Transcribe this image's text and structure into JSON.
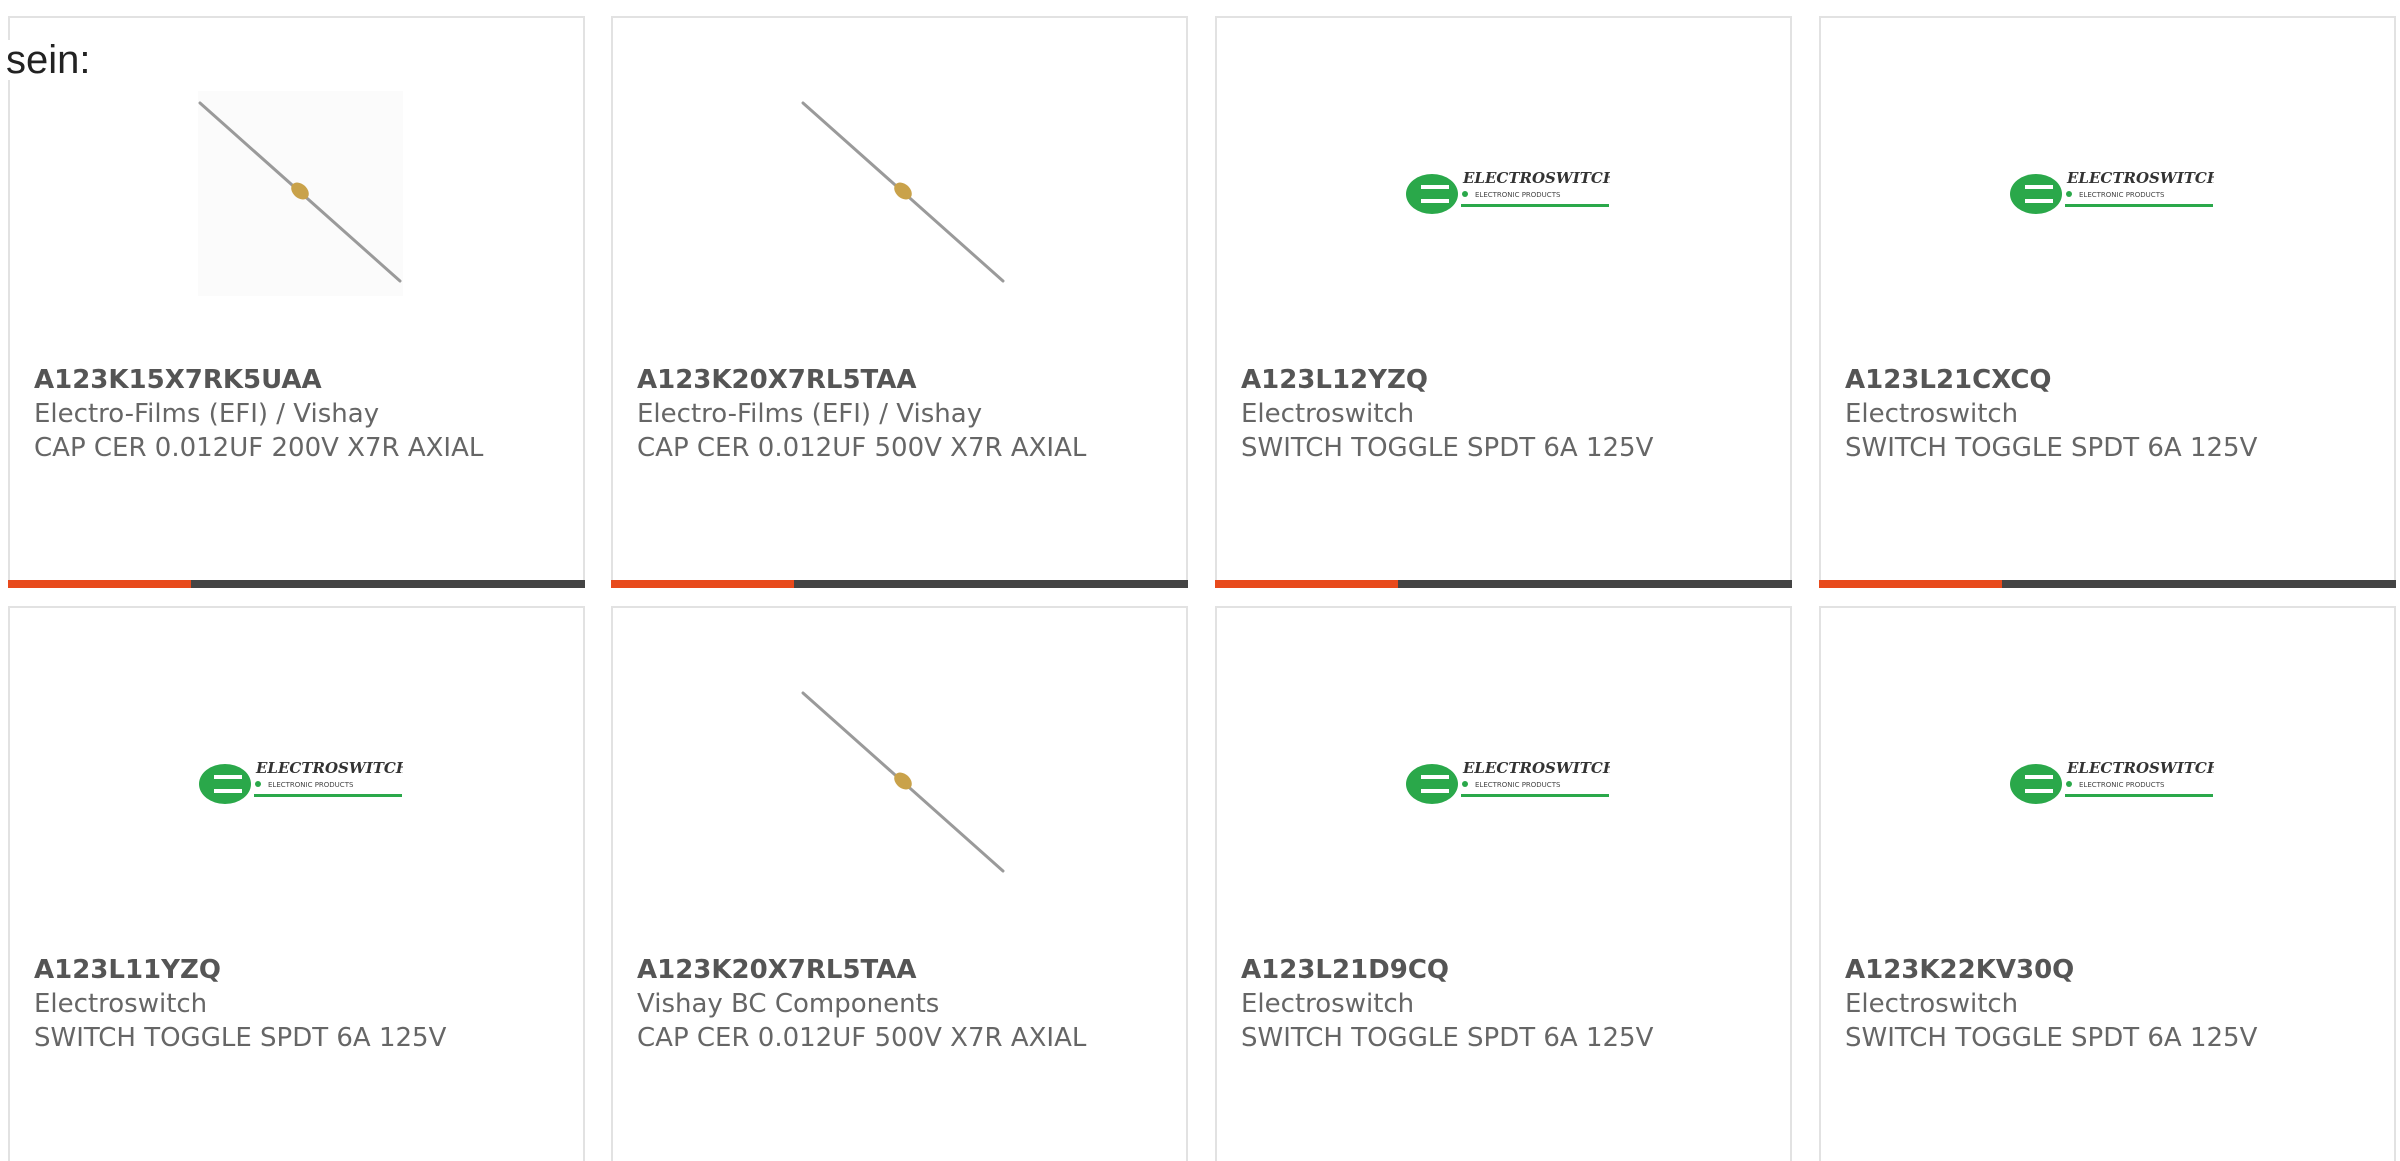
{
  "intro_text": "sein:",
  "colors": {
    "accent": "#e84a1c",
    "bar": "#444444",
    "logo_green": "#2aa84a"
  },
  "cards": [
    {
      "part": "A123K15X7RK5UAA",
      "manufacturer": "Electro-Films (EFI) / Vishay",
      "description": "CAP CER 0.012UF 200V X7R AXIAL",
      "image": "capacitor-image",
      "has_bar": true
    },
    {
      "part": "A123K20X7RL5TAA",
      "manufacturer": "Electro-Films (EFI) / Vishay",
      "description": "CAP CER 0.012UF 500V X7R AXIAL",
      "image": "capacitor-image",
      "has_bar": true
    },
    {
      "part": "A123L12YZQ",
      "manufacturer": "Electroswitch",
      "description": "SWITCH TOGGLE SPDT 6A 125V",
      "image": "electroswitch-logo",
      "logo_title": "ELECTROSWITCH",
      "logo_subtitle": "ELECTRONIC PRODUCTS",
      "has_bar": true
    },
    {
      "part": "A123L21CXCQ",
      "manufacturer": "Electroswitch",
      "description": "SWITCH TOGGLE SPDT 6A 125V",
      "image": "electroswitch-logo",
      "logo_title": "ELECTROSWITCH",
      "logo_subtitle": "ELECTRONIC PRODUCTS",
      "has_bar": true
    },
    {
      "part": "A123L11YZQ",
      "manufacturer": "Electroswitch",
      "description": "SWITCH TOGGLE SPDT 6A 125V",
      "image": "electroswitch-logo",
      "logo_title": "ELECTROSWITCH",
      "logo_subtitle": "ELECTRONIC PRODUCTS",
      "has_bar": false
    },
    {
      "part": "A123K20X7RL5TAA",
      "manufacturer": "Vishay BC Components",
      "description": "CAP CER 0.012UF 500V X7R AXIAL",
      "image": "capacitor-image",
      "has_bar": false
    },
    {
      "part": "A123L21D9CQ",
      "manufacturer": "Electroswitch",
      "description": "SWITCH TOGGLE SPDT 6A 125V",
      "image": "electroswitch-logo",
      "logo_title": "ELECTROSWITCH",
      "logo_subtitle": "ELECTRONIC PRODUCTS",
      "has_bar": false
    },
    {
      "part": "A123K22KV30Q",
      "manufacturer": "Electroswitch",
      "description": "SWITCH TOGGLE SPDT 6A 125V",
      "image": "electroswitch-logo",
      "logo_title": "ELECTROSWITCH",
      "logo_subtitle": "ELECTRONIC PRODUCTS",
      "has_bar": false
    }
  ]
}
